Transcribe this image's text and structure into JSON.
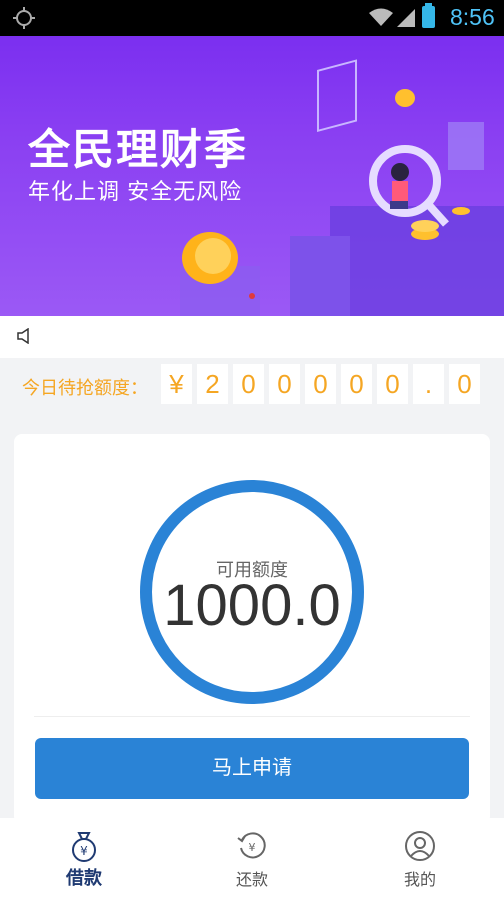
{
  "status_bar": {
    "time": "8:56",
    "icons": [
      "gps-icon",
      "wifi-icon",
      "signal-icon",
      "battery-icon"
    ]
  },
  "banner": {
    "title": "全民理财季",
    "subtitle": "年化上调  安全无风险"
  },
  "quota": {
    "label": "今日待抢额度：",
    "digits": [
      "¥",
      "2",
      "0",
      "0",
      "0",
      "0",
      "0",
      ".",
      "0"
    ]
  },
  "credit": {
    "label": "可用额度",
    "value": "1000.0",
    "ring_color": "#2a83d6"
  },
  "apply_button": "马上申请",
  "tabs": [
    {
      "label": "借款",
      "icon": "loan-bag-icon",
      "active": true
    },
    {
      "label": "还款",
      "icon": "repay-icon",
      "active": false
    },
    {
      "label": "我的",
      "icon": "profile-icon",
      "active": false
    }
  ],
  "colors": {
    "primary": "#2a83d6",
    "accent": "#f5a623",
    "banner": "#8a3ff2"
  }
}
